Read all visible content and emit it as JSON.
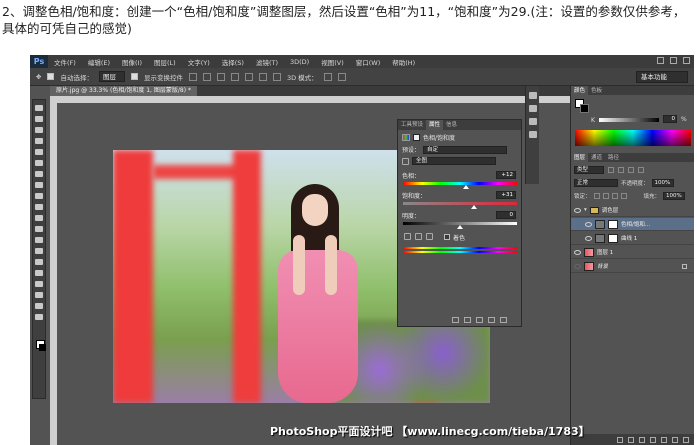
{
  "caption": "2、调整色相/饱和度：创建一个“色相/饱和度”调整图层，然后设置“色相”为11，“饱和度”为29.(注：设置的参数仅供参考，具体的可凭自己的感觉)",
  "app": {
    "logo": "Ps",
    "menu": [
      "文件(F)",
      "编辑(E)",
      "图像(I)",
      "图层(L)",
      "文字(Y)",
      "选择(S)",
      "滤镜(T)",
      "3D(D)",
      "视图(V)",
      "窗口(W)",
      "帮助(H)"
    ],
    "options": {
      "auto_select_label": "自动选择：",
      "auto_select_value": "图层",
      "show_transform_label": "显示变换控件",
      "mode_3d_label": "3D 模式：",
      "workspace": "基本功能"
    },
    "document_tab": "原片.jpg @ 33.3% (色相/饱和度 1, 图层蒙版/8) *"
  },
  "properties_panel": {
    "tabs": [
      "工具预设",
      "属性",
      "信息"
    ],
    "active_tab": "属性",
    "title": "色相/饱和度",
    "preset_label": "预设：",
    "preset_value": "自定",
    "channel_value": "全图",
    "hue_label": "色相：",
    "hue_value": "+12",
    "hue_fraction": 0.55,
    "saturation_label": "饱和度：",
    "saturation_value": "+31",
    "saturation_fraction": 0.62,
    "lightness_label": "明度：",
    "lightness_value": "0",
    "lightness_fraction": 0.5,
    "colorize_label": "着色"
  },
  "right_panel": {
    "tabs": [
      "颜色",
      "色板"
    ],
    "k_label": "K",
    "k_value": "0",
    "k_unit": "%",
    "layers_tabs": [
      "图层",
      "通道",
      "路径"
    ],
    "kind_filter": "类型",
    "blend_mode": "正常",
    "opacity_label": "不透明度：",
    "opacity_value": "100%",
    "lock_label": "锁定：",
    "fill_label": "填充：",
    "fill_value": "100%",
    "layers": [
      {
        "name": "调色层",
        "type": "group"
      },
      {
        "name": "色相/饱和...",
        "type": "adjustment"
      },
      {
        "name": "曲线 1",
        "type": "adjustment"
      },
      {
        "name": "图层 1",
        "type": "pixel"
      },
      {
        "name": "背景",
        "type": "background"
      }
    ]
  },
  "watermark": "PhotoShop平面设计吧  【www.linecg.com/tieba/1783】",
  "colors": {
    "ps_dark": "#3c3c3c",
    "ps_panel": "#535353",
    "selected_layer": "#5c6f89",
    "red_pole": "#ef3b3b"
  }
}
